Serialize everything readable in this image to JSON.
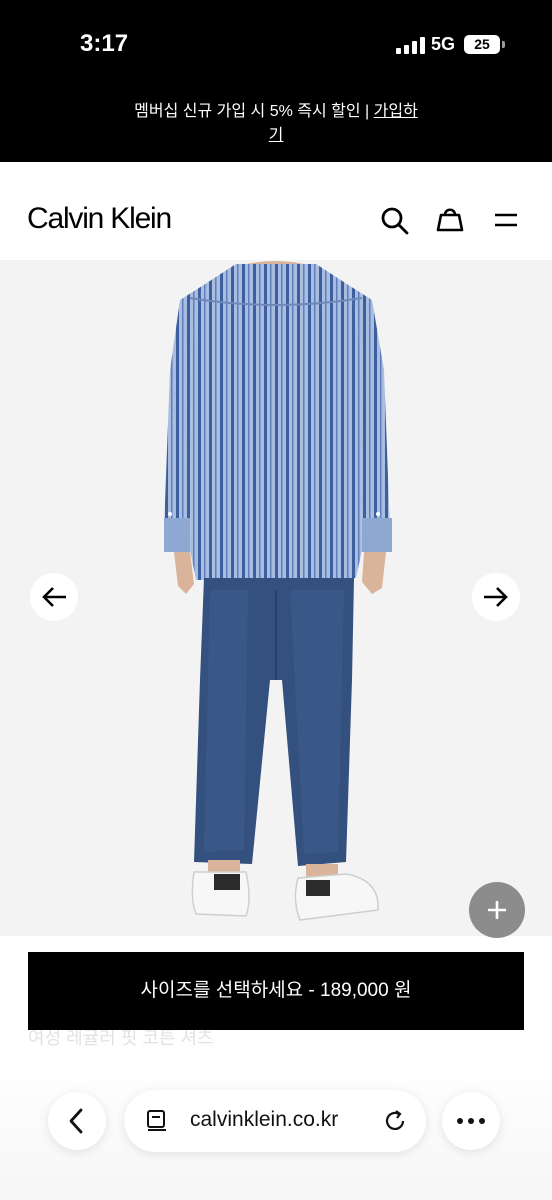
{
  "status_bar": {
    "time": "3:17",
    "network": "5G",
    "battery": "25"
  },
  "promo": {
    "text": "멤버십 신규 가입 시 5% 즉시 할인 | ",
    "link": "가입하기"
  },
  "header": {
    "logo": "Calvin Klein",
    "icons": [
      "search-icon",
      "bag-icon",
      "menu-icon"
    ]
  },
  "gallery": {
    "prev_icon": "arrow-left-icon",
    "next_icon": "arrow-right-icon",
    "expand_icon": "plus-icon",
    "colors": {
      "shirt": "#8fa8d2",
      "stripe": "#3d5f9e",
      "jeans": "#34507e",
      "background": "#f3f3f3"
    }
  },
  "product": {
    "faded_title": "여성 레귤러 핏 코튼 셔츠"
  },
  "cta": {
    "label": "사이즈를 선택하세요 - 189,000 원"
  },
  "browser": {
    "url": "calvinklein.co.kr",
    "back_icon": "chevron-left-icon",
    "reload_icon": "reload-icon",
    "more_icon": "more-icon",
    "tabs_icon": "page-icon"
  }
}
